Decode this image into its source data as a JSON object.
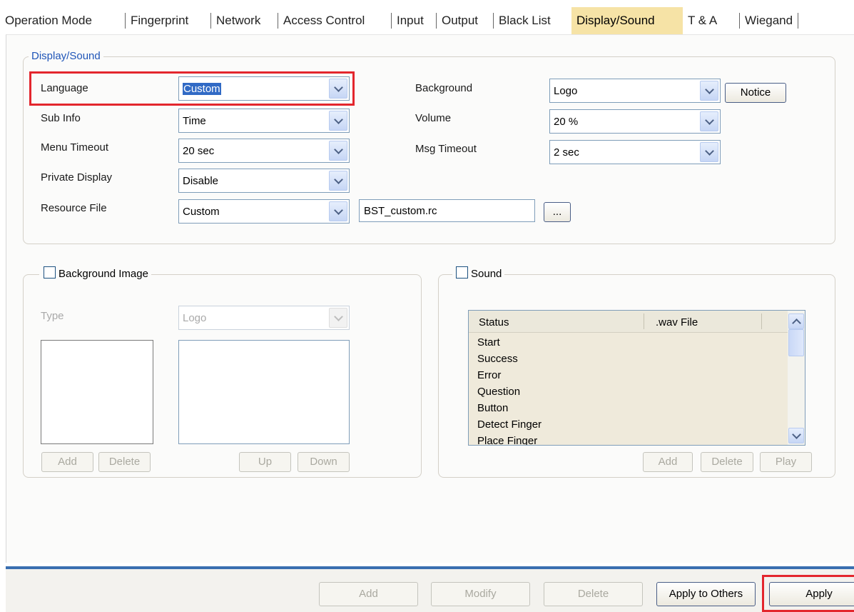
{
  "tabs": [
    {
      "label": "Operation Mode",
      "active": false
    },
    {
      "label": "Fingerprint",
      "active": false
    },
    {
      "label": "Network",
      "active": false
    },
    {
      "label": "Access Control",
      "active": false
    },
    {
      "label": "Input",
      "active": false
    },
    {
      "label": "Output",
      "active": false
    },
    {
      "label": "Black List",
      "active": false
    },
    {
      "label": "Display/Sound",
      "active": true
    },
    {
      "label": "T & A",
      "active": false
    },
    {
      "label": "Wiegand",
      "active": false
    }
  ],
  "display_sound": {
    "legend": "Display/Sound",
    "language": {
      "label": "Language",
      "value": "Custom"
    },
    "sub_info": {
      "label": "Sub Info",
      "value": "Time"
    },
    "menu_timeout": {
      "label": "Menu Timeout",
      "value": "20 sec"
    },
    "private_display": {
      "label": "Private Display",
      "value": "Disable"
    },
    "resource_file": {
      "label": "Resource File",
      "value": "Custom",
      "path": "BST_custom.rc",
      "browse_label": "..."
    },
    "background": {
      "label": "Background",
      "value": "Logo",
      "notice_label": "Notice"
    },
    "volume": {
      "label": "Volume",
      "value": "20 %"
    },
    "msg_timeout": {
      "label": "Msg Timeout",
      "value": "2 sec"
    }
  },
  "background_image": {
    "legend": "Background Image",
    "checked": false,
    "type_label": "Type",
    "type_value": "Logo",
    "add_label": "Add",
    "delete_label": "Delete",
    "up_label": "Up",
    "down_label": "Down"
  },
  "sound": {
    "legend": "Sound",
    "checked": false,
    "columns": [
      "Status",
      ".wav File"
    ],
    "rows": [
      "Start",
      "Success",
      "Error",
      "Question",
      "Button",
      "Detect Finger",
      "Place Finger"
    ],
    "add_label": "Add",
    "delete_label": "Delete",
    "play_label": "Play"
  },
  "bottom": {
    "add_label": "Add",
    "modify_label": "Modify",
    "delete_label": "Delete",
    "apply_others_label": "Apply to Others",
    "apply_label": "Apply"
  },
  "colors": {
    "active_tab": "#f6e3a6",
    "highlight": "#e3262d",
    "selection": "#316ac5",
    "legend_text": "#1f55b8"
  }
}
